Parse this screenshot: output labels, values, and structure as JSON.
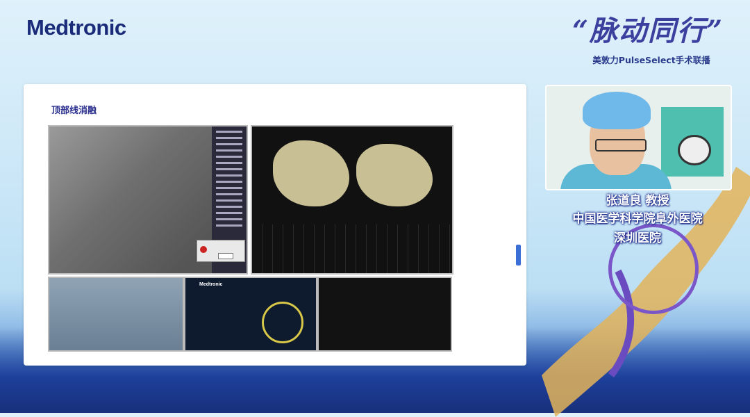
{
  "header": {
    "brand": "Medtronic",
    "event_title": "“脉动同行”",
    "event_subtitle": "美敦力PulseSelect手术联播"
  },
  "slide": {
    "title": "顶部线消融",
    "generator_brand": "Medtronic"
  },
  "speaker": {
    "name": "张道良 教授",
    "affiliation_line1": "中国医学科学院阜外医院",
    "affiliation_line2": "深圳医院"
  },
  "colors": {
    "brand": "#1a2b7a",
    "accent": "#3b3f9e",
    "speaker_text_outline": "#1b2b8a"
  }
}
